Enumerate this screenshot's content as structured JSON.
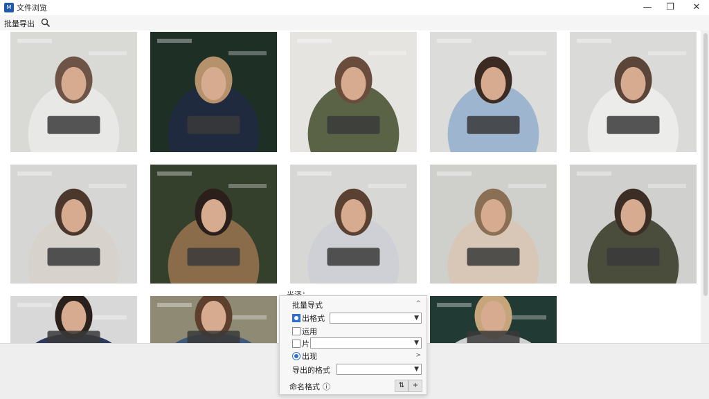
{
  "window": {
    "title": "文件浏览",
    "minimize": "—",
    "maximize": "❐",
    "close": "✕"
  },
  "toolbar": {
    "label": "批量导出"
  },
  "gallery": {
    "photos": [
      {
        "name": "woman-tablet-office-1",
        "bg": "#d9d9d6",
        "fg": "#6d5446",
        "shirt": "#e8e8e6"
      },
      {
        "name": "woman-dark-bokeh",
        "bg": "#1e3026",
        "fg": "#b5926b",
        "shirt": "#1f2a3f"
      },
      {
        "name": "woman-green-sweater",
        "bg": "#e6e4e0",
        "fg": "#6a4c3c",
        "shirt": "#5b6346"
      },
      {
        "name": "woman-curly-hair-tablet",
        "bg": "#dcdcda",
        "fg": "#3b2b22",
        "shirt": "#9db5cf"
      },
      {
        "name": "woman-tablet-office-2",
        "bg": "#dadad8",
        "fg": "#5b4538",
        "shirt": "#ececea"
      },
      {
        "name": "woman-hand-on-chin",
        "bg": "#d6d6d4",
        "fg": "#4b372c",
        "shirt": "#d7d2cc"
      },
      {
        "name": "woman-forest-blazer",
        "bg": "#34402c",
        "fg": "#2a1f1a",
        "shirt": "#8a6b4a"
      },
      {
        "name": "woman-phone-office",
        "bg": "#d7d7d5",
        "fg": "#5a4131",
        "shirt": "#cfcfd6"
      },
      {
        "name": "woman-glasses-tablet",
        "bg": "#cfcfcc",
        "fg": "#8a6f55",
        "shirt": "#d8c7b6"
      },
      {
        "name": "man-glasses-tablet",
        "bg": "#d0d0ce",
        "fg": "#3c2e25",
        "shirt": "#4a4d3c"
      },
      {
        "name": "man-glasses-portrait",
        "bg": "#d8d8d8",
        "fg": "#2a211c",
        "shirt": "#2d3a5c"
      },
      {
        "name": "woman-field-landscape",
        "bg": "#8e8a74",
        "fg": "#5c3f2c",
        "shirt": "#3d5a7a"
      },
      {
        "name": "man-office-chair",
        "bg": "#d2d2d0",
        "fg": "#3a2b22",
        "shirt": "#2c3f66"
      },
      {
        "name": "woman-blonde-portrait",
        "bg": "#213a33",
        "fg": "#c7a57a",
        "shirt": "#cfcfcf"
      }
    ]
  },
  "float_label": "光泽：",
  "export_popup": {
    "title": "批量导式",
    "title_chevron": "^",
    "option1_label": "出格式",
    "option1_value": "",
    "option2_label": "运用",
    "option3_label": "片",
    "option3_value": "",
    "option4_label": "出现",
    "option4_chevron": ">",
    "format_label": "导出的格式",
    "format_value": "",
    "bottom_label": "命名格式",
    "info_icon": "ⓘ",
    "btn_sort": "⇅",
    "btn_add": "+"
  }
}
